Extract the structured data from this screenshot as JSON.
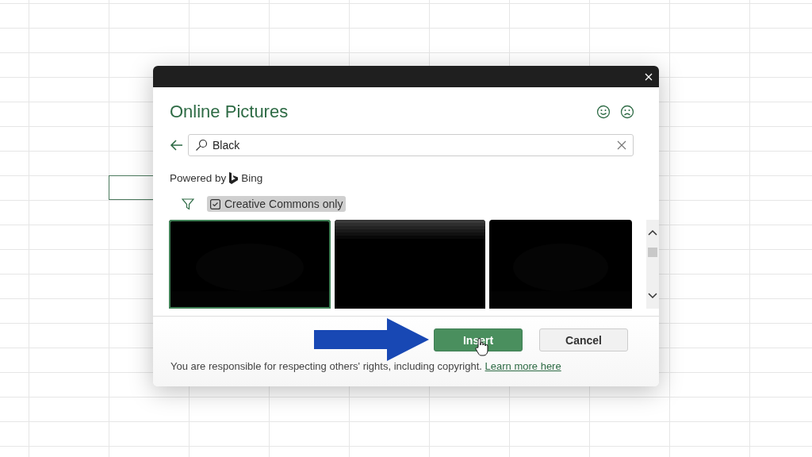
{
  "dialog": {
    "title": "Online Pictures",
    "search": {
      "value": "Black"
    },
    "powered_by": "Powered by",
    "provider": "Bing",
    "filter": {
      "label": "Creative Commons only",
      "checked": true
    },
    "results": [
      {
        "kind": "picture",
        "selected": true
      },
      {
        "kind": "picture",
        "selected": false
      },
      {
        "kind": "picture",
        "selected": false
      }
    ],
    "buttons": [
      {
        "label": "Insert",
        "kind": "primary"
      },
      {
        "label": "Cancel",
        "kind": "secondary"
      }
    ],
    "notice": "You are responsible for respecting others' rights, including copyright.",
    "link": "Learn more here"
  }
}
